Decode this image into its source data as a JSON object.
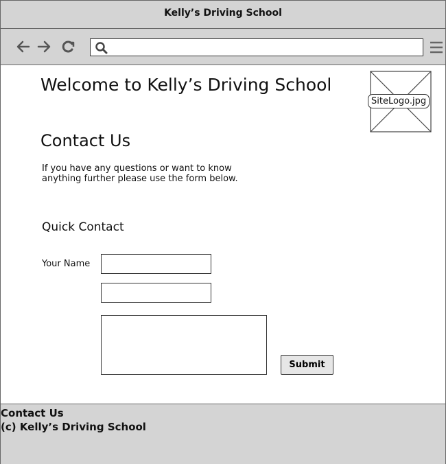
{
  "window": {
    "title": "Kelly’s Driving School"
  },
  "browser": {
    "address_value": "",
    "icons": [
      "back-arrow-icon",
      "forward-arrow-icon",
      "reload-icon",
      "search-icon",
      "menu-icon"
    ]
  },
  "header": {
    "heading": "Welcome to Kelly’s Driving School",
    "logo_label": "SiteLogo.jpg"
  },
  "main": {
    "title": "Contact Us",
    "intro_line1": "If you have any questions or want to know",
    "intro_line2": "anything further please use the form below."
  },
  "form": {
    "title": "Quick Contact",
    "name_label": "Your Name",
    "name_value": "",
    "email_value": "",
    "message_value": "",
    "submit_label": "Submit"
  },
  "footer": {
    "link": "Contact Us",
    "copyright": "(c) Kelly’s Driving School"
  },
  "colors": {
    "chrome": "#d4d4d4",
    "border": "#333333",
    "page": "#ffffff"
  }
}
